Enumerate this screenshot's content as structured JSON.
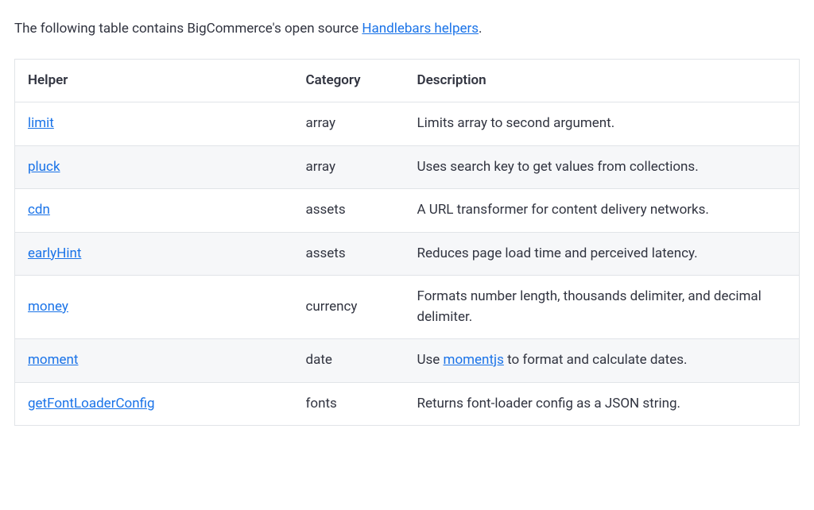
{
  "intro": {
    "prefix": "The following table contains BigCommerce's open source ",
    "linkText": "Handlebars helpers",
    "suffix": "."
  },
  "table": {
    "headers": {
      "helper": "Helper",
      "category": "Category",
      "description": "Description"
    },
    "rows": [
      {
        "helper": "limit",
        "category": "array",
        "descPrefix": "Limits array to second argument.",
        "descLink": "",
        "descSuffix": ""
      },
      {
        "helper": "pluck",
        "category": "array",
        "descPrefix": "Uses search key to get values from collections.",
        "descLink": "",
        "descSuffix": ""
      },
      {
        "helper": "cdn",
        "category": "assets",
        "descPrefix": "A URL transformer for content delivery networks.",
        "descLink": "",
        "descSuffix": ""
      },
      {
        "helper": "earlyHint",
        "category": "assets",
        "descPrefix": "Reduces page load time and perceived latency.",
        "descLink": "",
        "descSuffix": ""
      },
      {
        "helper": "money",
        "category": "currency",
        "descPrefix": "Formats number length, thousands delimiter, and decimal delimiter.",
        "descLink": "",
        "descSuffix": ""
      },
      {
        "helper": "moment",
        "category": "date",
        "descPrefix": "Use ",
        "descLink": "momentjs",
        "descSuffix": " to format and calculate dates."
      },
      {
        "helper": "getFontLoaderConfig",
        "category": "fonts",
        "descPrefix": "Returns font-loader config as a JSON string.",
        "descLink": "",
        "descSuffix": ""
      }
    ]
  }
}
